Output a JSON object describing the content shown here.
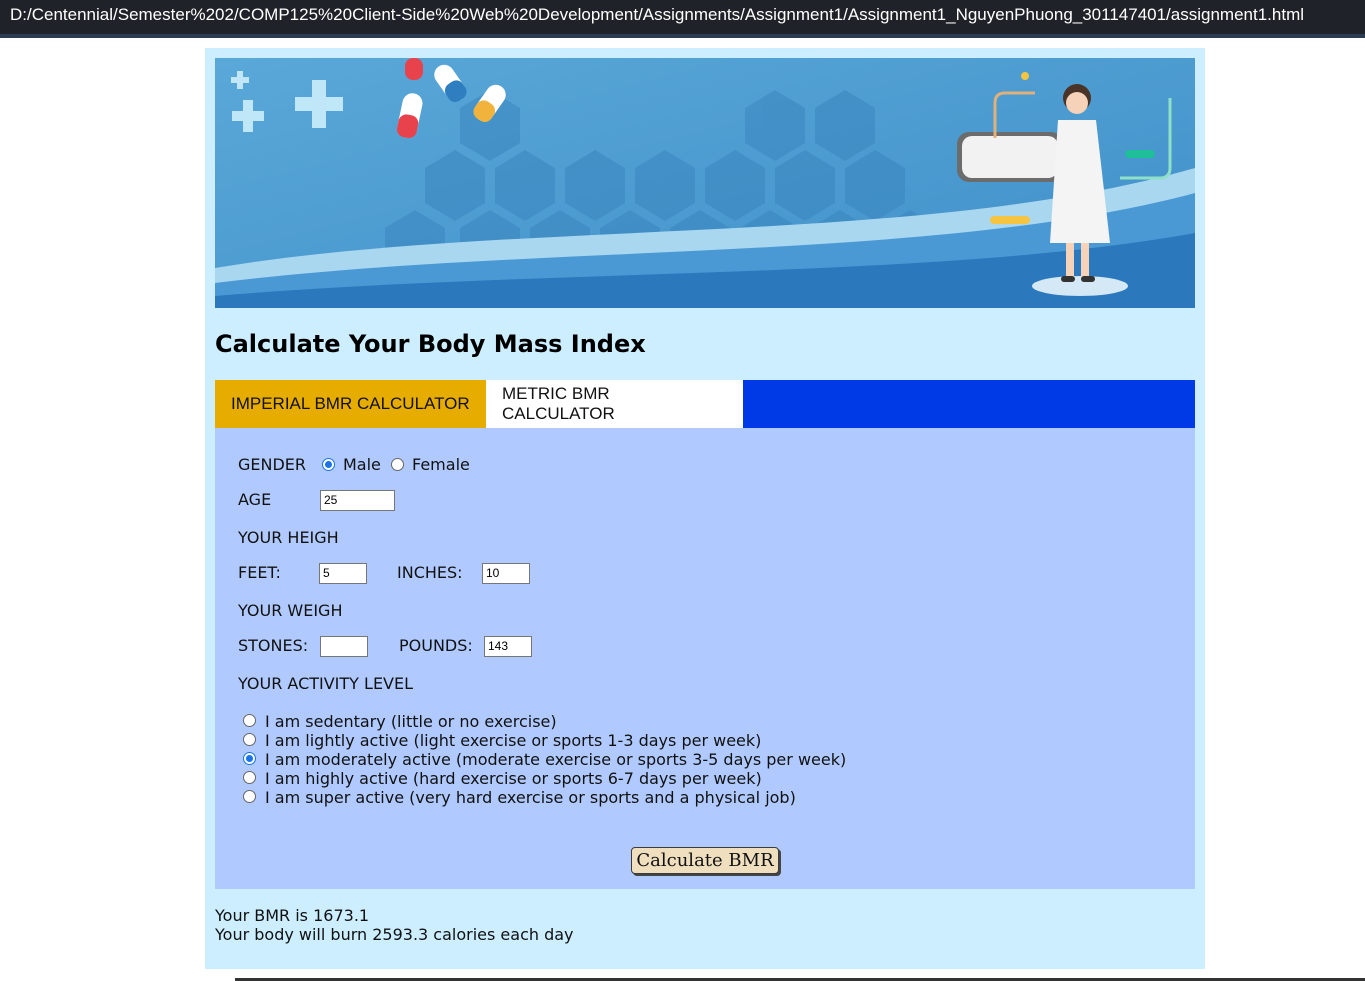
{
  "window": {
    "title": "D:/Centennial/Semester%202/COMP125%20Client-Side%20Web%20Development/Assignments/Assignment1/Assignment1_NguyenPhuong_301147401/assignment1.html"
  },
  "colors": {
    "page_bg": "#cceeff",
    "tab_active": "#e6ad00",
    "tab_bar": "#0039e6",
    "form_bg": "#b0caff"
  },
  "page": {
    "heading": "Calculate Your Body Mass Index"
  },
  "tabs": [
    {
      "label": "IMPERIAL BMR CALCULATOR",
      "active": true
    },
    {
      "label": "METRIC BMR CALCULATOR",
      "active": false
    }
  ],
  "form": {
    "gender_label": "GENDER",
    "gender_options": [
      "Male",
      "Female"
    ],
    "gender_selected": "Male",
    "age_label": "AGE",
    "age_value": "25",
    "height_label": "YOUR HEIGH",
    "feet_label": "FEET:",
    "feet_value": "5",
    "inches_label": "INCHES:",
    "inches_value": "10",
    "weight_label": "YOUR WEIGH",
    "stones_label": "STONES:",
    "stones_value": "",
    "pounds_label": "POUNDS:",
    "pounds_value": "143",
    "activity_label": "YOUR ACTIVITY LEVEL",
    "activity_options": [
      "I am sedentary (little or no exercise)",
      "I am lightly active (light exercise or sports 1-3 days per week)",
      "I am moderately active (moderate exercise or sports 3-5 days per week)",
      "I am highly active (hard exercise or sports 6-7 days per week)",
      "I am super active (very hard exercise or sports and a physical job)"
    ],
    "activity_selected_index": 2,
    "calculate_label": "Calculate BMR"
  },
  "result": {
    "bmr_line": "Your BMR is 1673.1",
    "calories_line": "Your body will burn 2593.3 calories each day"
  }
}
